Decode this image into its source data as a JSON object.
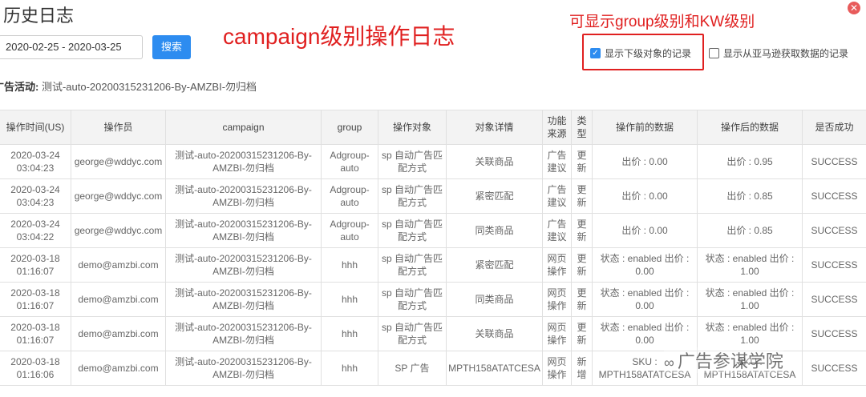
{
  "header": {
    "title": "历史日志"
  },
  "annotations": {
    "campaign_level": "campaign级别操作日志",
    "kw_level": "可显示group级别和KW级别"
  },
  "filters": {
    "date_range": "2020-02-25 - 2020-03-25",
    "search_label": "搜索",
    "show_sub_objects_label": "显示下级对象的记录",
    "show_sub_objects_checked": true,
    "show_amazon_label": "显示从亚马逊获取数据的记录",
    "show_amazon_checked": false
  },
  "campaign_info": {
    "label": "广告活动:",
    "value": "测试-auto-20200315231206-By-AMZBI-勿归档"
  },
  "table": {
    "headers": [
      "操作时间(US)",
      "操作员",
      "campaign",
      "group",
      "操作对象",
      "对象详情",
      "功能来源",
      "类型",
      "操作前的数据",
      "操作后的数据",
      "是否成功"
    ],
    "rows": [
      [
        "2020-03-24 03:04:23",
        "george@wddyc.com",
        "测试-auto-20200315231206-By-AMZBI-勿归档",
        "Adgroup-auto",
        "sp 自动广告匹配方式",
        "关联商品",
        "广告建议",
        "更新",
        "出价 : 0.00",
        "出价 : 0.95",
        "SUCCESS"
      ],
      [
        "2020-03-24 03:04:23",
        "george@wddyc.com",
        "测试-auto-20200315231206-By-AMZBI-勿归档",
        "Adgroup-auto",
        "sp 自动广告匹配方式",
        "紧密匹配",
        "广告建议",
        "更新",
        "出价 : 0.00",
        "出价 : 0.85",
        "SUCCESS"
      ],
      [
        "2020-03-24 03:04:22",
        "george@wddyc.com",
        "测试-auto-20200315231206-By-AMZBI-勿归档",
        "Adgroup-auto",
        "sp 自动广告匹配方式",
        "同类商品",
        "广告建议",
        "更新",
        "出价 : 0.00",
        "出价 : 0.85",
        "SUCCESS"
      ],
      [
        "2020-03-18 01:16:07",
        "demo@amzbi.com",
        "测试-auto-20200315231206-By-AMZBI-勿归档",
        "hhh",
        "sp 自动广告匹配方式",
        "紧密匹配",
        "网页操作",
        "更新",
        "状态 : enabled 出价 : 0.00",
        "状态 : enabled 出价 : 1.00",
        "SUCCESS"
      ],
      [
        "2020-03-18 01:16:07",
        "demo@amzbi.com",
        "测试-auto-20200315231206-By-AMZBI-勿归档",
        "hhh",
        "sp 自动广告匹配方式",
        "同类商品",
        "网页操作",
        "更新",
        "状态 : enabled 出价 : 0.00",
        "状态 : enabled 出价 : 1.00",
        "SUCCESS"
      ],
      [
        "2020-03-18 01:16:07",
        "demo@amzbi.com",
        "测试-auto-20200315231206-By-AMZBI-勿归档",
        "hhh",
        "sp 自动广告匹配方式",
        "关联商品",
        "网页操作",
        "更新",
        "状态 : enabled 出价 : 0.00",
        "状态 : enabled 出价 : 1.00",
        "SUCCESS"
      ],
      [
        "2020-03-18 01:16:06",
        "demo@amzbi.com",
        "测试-auto-20200315231206-By-AMZBI-勿归档",
        "hhh",
        "SP 广告",
        "MPTH158ATATCESA",
        "网页操作",
        "新增",
        "SKU : MPTH158ATATCESA",
        "SKU : MPTH158ATATCESA",
        "SUCCESS"
      ]
    ]
  },
  "watermark": {
    "text": "广告参谋学院"
  },
  "colors": {
    "accent": "#2d8cf0",
    "annotation": "#e02020"
  }
}
